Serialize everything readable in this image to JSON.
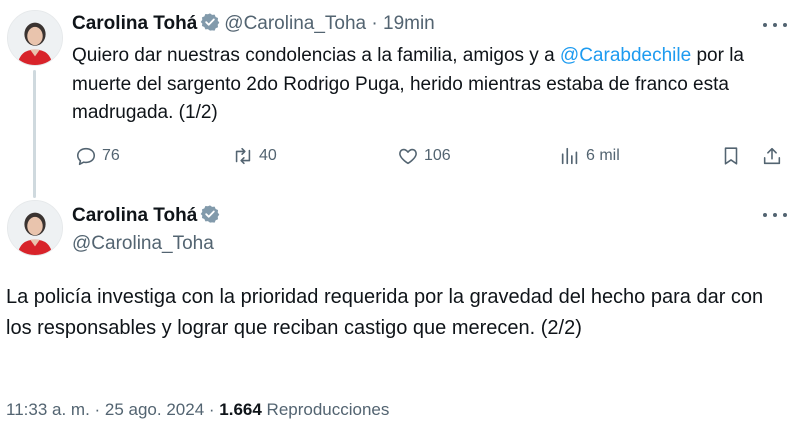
{
  "tweet1": {
    "author_name": "Carolina Tohá",
    "handle": "@Carolina_Toha",
    "separator": "·",
    "time": "19min",
    "text_before_mention": "Quiero dar nuestras condolencias a la familia, amigos y a ",
    "mention": "@Carabdechile",
    "text_after_mention": " por la muerte del sargento 2do Rodrigo Puga, herido mientras estaba de franco esta madrugada. (1/2)",
    "replies": "76",
    "reposts": "40",
    "likes": "106",
    "views": "6 mil"
  },
  "tweet2": {
    "author_name": "Carolina Tohá",
    "handle": "@Carolina_Toha",
    "text": "La policía investiga con la prioridad requerida por la gravedad del hecho para dar con los responsables y lograr que reciban castigo que merecen. (2/2)",
    "timestamp": "11:33 a. m. · 25 ago. 2024 · ",
    "view_count": "1.664",
    "view_label": " Reproducciones"
  },
  "colors": {
    "text_primary": "#0f1419",
    "text_secondary": "#536471",
    "accent": "#1d9bf0",
    "thread_line": "#cfd9de"
  },
  "icons": {
    "reply": "reply-icon",
    "repost": "repost-icon",
    "like": "like-icon",
    "views": "views-icon",
    "bookmark": "bookmark-icon",
    "share": "share-icon",
    "verified": "verified-badge-icon",
    "more": "more-icon"
  }
}
